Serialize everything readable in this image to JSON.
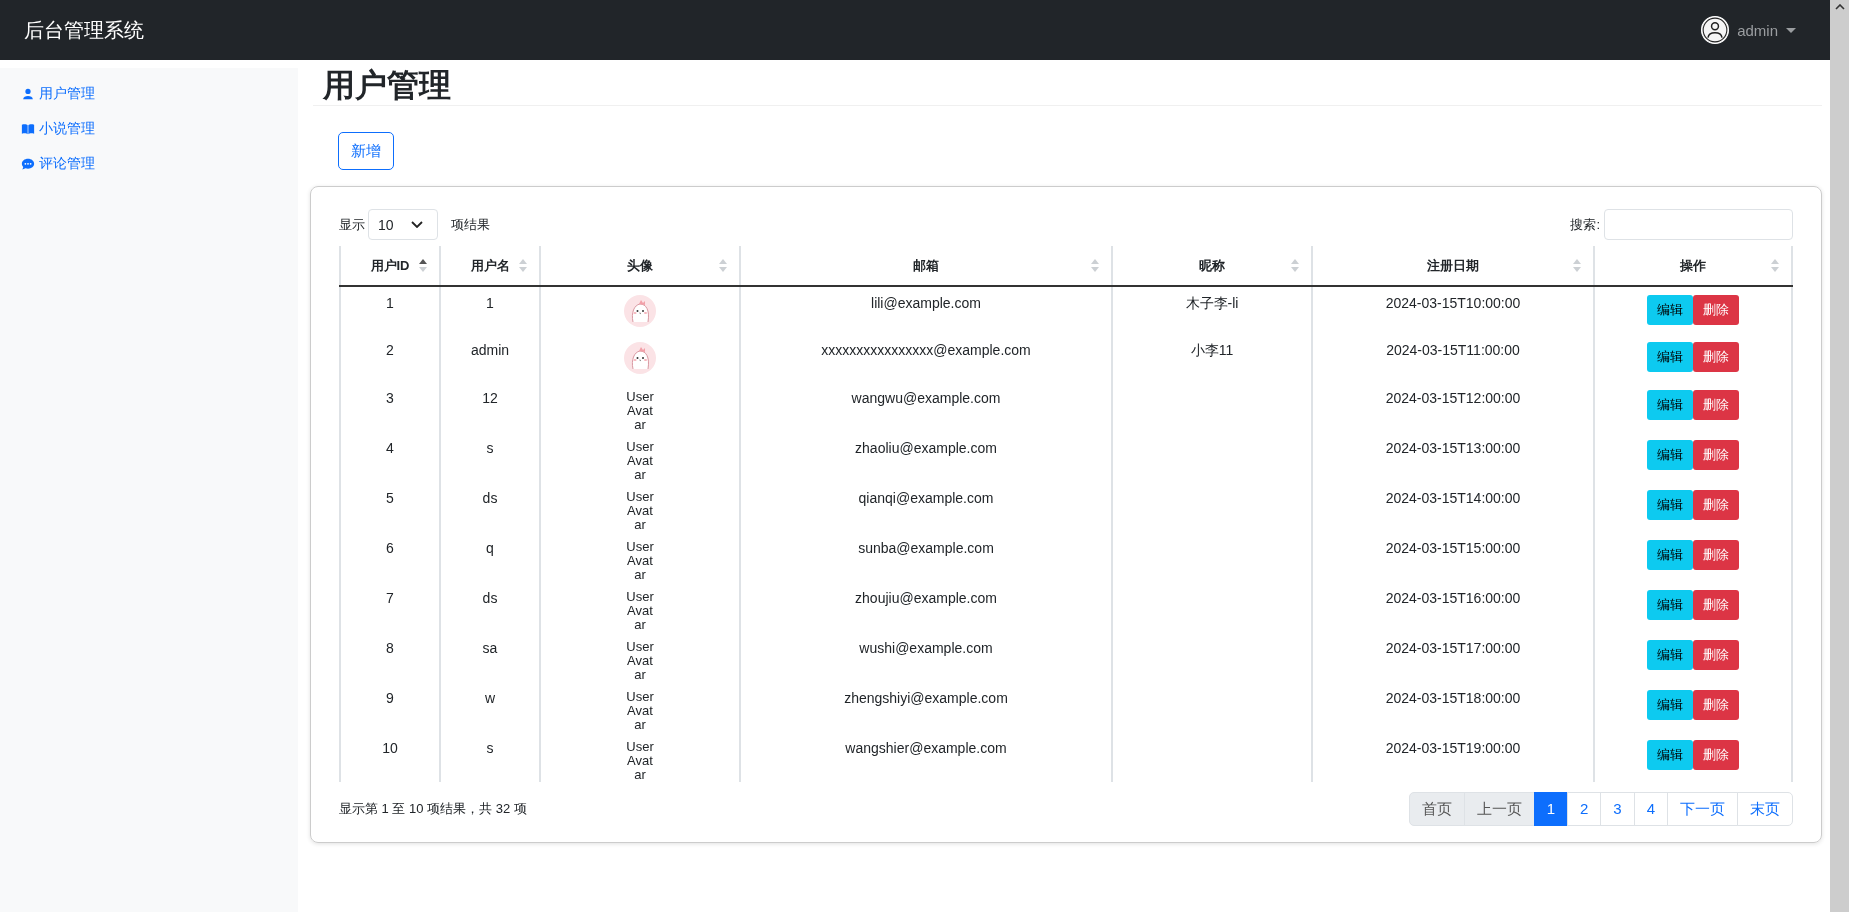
{
  "navbar": {
    "brand": "后台管理系统",
    "user": {
      "name": "admin"
    }
  },
  "sidebar": {
    "items": [
      {
        "label": "用户管理",
        "kind": "user"
      },
      {
        "label": "小说管理",
        "kind": "book"
      },
      {
        "label": "评论管理",
        "kind": "comment"
      }
    ]
  },
  "page_title": "用户管理",
  "add_button": "新增",
  "table_controls": {
    "length_before": "显示",
    "length_value": "10",
    "length_after": "项结果",
    "search_label": "搜索:"
  },
  "table": {
    "columns": [
      {
        "label": "用户ID",
        "sorted_ascending": true
      },
      {
        "label": "用户名",
        "sorted_ascending": false
      },
      {
        "label": "头像",
        "sorted_ascending": false
      },
      {
        "label": "邮箱",
        "sorted_ascending": false
      },
      {
        "label": "昵称",
        "sorted_ascending": false
      },
      {
        "label": "注册日期",
        "sorted_ascending": false
      },
      {
        "label": "操作",
        "sorted_ascending": false
      }
    ],
    "rows": [
      {
        "id": "1",
        "username": "1",
        "avatar": {
          "kind": "image"
        },
        "email": "lili@example.com",
        "nickname": "木子李-li",
        "registered": "2024-03-15T10:00:00",
        "actions": [
          "编辑",
          "删除"
        ]
      },
      {
        "id": "2",
        "username": "admin",
        "avatar": {
          "kind": "image"
        },
        "email": "xxxxxxxxxxxxxxxx@example.com",
        "nickname": "小李11",
        "registered": "2024-03-15T11:00:00",
        "actions": [
          "编辑",
          "删除"
        ]
      },
      {
        "id": "3",
        "username": "12",
        "avatar": {
          "kind": "text",
          "alt": "User Avatar"
        },
        "email": "wangwu@example.com",
        "registered": "2024-03-15T12:00:00",
        "actions": [
          "编辑",
          "删除"
        ]
      },
      {
        "id": "4",
        "username": "s",
        "avatar": {
          "kind": "text",
          "alt": "User Avatar"
        },
        "email": "zhaoliu@example.com",
        "registered": "2024-03-15T13:00:00",
        "actions": [
          "编辑",
          "删除"
        ]
      },
      {
        "id": "5",
        "username": "ds",
        "avatar": {
          "kind": "text",
          "alt": "User Avatar"
        },
        "email": "qianqi@example.com",
        "registered": "2024-03-15T14:00:00",
        "actions": [
          "编辑",
          "删除"
        ]
      },
      {
        "id": "6",
        "username": "q",
        "avatar": {
          "kind": "text",
          "alt": "User Avatar"
        },
        "email": "sunba@example.com",
        "registered": "2024-03-15T15:00:00",
        "actions": [
          "编辑",
          "删除"
        ]
      },
      {
        "id": "7",
        "username": "ds",
        "avatar": {
          "kind": "text",
          "alt": "User Avatar"
        },
        "email": "zhoujiu@example.com",
        "registered": "2024-03-15T16:00:00",
        "actions": [
          "编辑",
          "删除"
        ]
      },
      {
        "id": "8",
        "username": "sa",
        "avatar": {
          "kind": "text",
          "alt": "User Avatar"
        },
        "email": "wushi@example.com",
        "registered": "2024-03-15T17:00:00",
        "actions": [
          "编辑",
          "删除"
        ]
      },
      {
        "id": "9",
        "username": "w",
        "avatar": {
          "kind": "text",
          "alt": "User Avatar"
        },
        "email": "zhengshiyi@example.com",
        "registered": "2024-03-15T18:00:00",
        "actions": [
          "编辑",
          "删除"
        ]
      },
      {
        "id": "10",
        "username": "s",
        "avatar": {
          "kind": "text",
          "alt": "User Avatar"
        },
        "email": "wangshier@example.com",
        "registered": "2024-03-15T19:00:00",
        "actions": [
          "编辑",
          "删除"
        ]
      }
    ]
  },
  "table_info": "显示第 1 至 10 项结果，共 32 项",
  "pagination": [
    {
      "label": "首页",
      "selected": false,
      "disabled": true
    },
    {
      "label": "上一页",
      "selected": false,
      "disabled": true
    },
    {
      "label": "1",
      "selected": true,
      "disabled": false
    },
    {
      "label": "2",
      "selected": false,
      "disabled": false
    },
    {
      "label": "3",
      "selected": false,
      "disabled": false
    },
    {
      "label": "4",
      "selected": false,
      "disabled": false
    },
    {
      "label": "下一页",
      "selected": false,
      "disabled": false
    },
    {
      "label": "末页",
      "selected": false,
      "disabled": false
    }
  ]
}
